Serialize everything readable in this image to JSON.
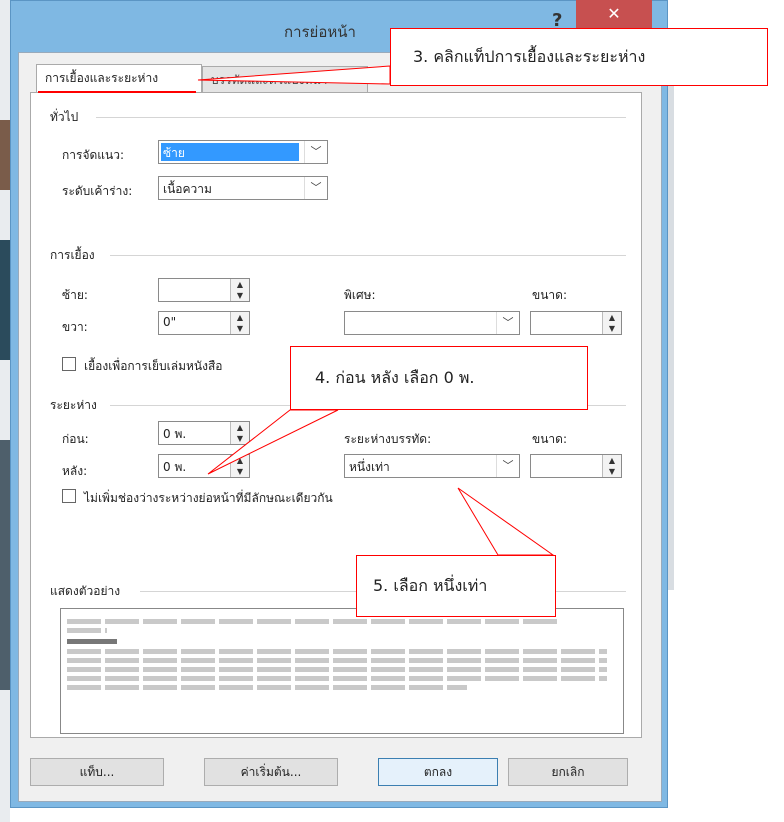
{
  "dialog": {
    "title": "การย่อหน้า",
    "help_label": "?",
    "close_label": "✕"
  },
  "tabs": [
    {
      "label": "การเยื้องและระยะห่าง",
      "active": true
    },
    {
      "label": "บรรทัดและตัวแบ่งหน้า",
      "active": false
    }
  ],
  "general": {
    "heading": "ทั่วไป",
    "alignment_label": "การจัดแนว:",
    "alignment_value": "ซ้าย",
    "outline_label": "ระดับเค้าร่าง:",
    "outline_value": "เนื้อความ"
  },
  "indent": {
    "heading": "การเยื้อง",
    "left_label": "ซ้าย:",
    "left_value": "",
    "right_label": "ขวา:",
    "right_value": "0\"",
    "special_label": "พิเศษ:",
    "special_value": "",
    "by_label": "ขนาด:",
    "by_value": "",
    "mirror_label": "เยื้องเพื่อการเย็บเล่มหนังสือ"
  },
  "spacing": {
    "heading": "ระยะห่าง",
    "before_label": "ก่อน:",
    "before_value": "0 พ.",
    "after_label": "หลัง:",
    "after_value": "0 พ.",
    "line_label": "ระยะห่างบรรทัด:",
    "line_value": "หนึ่งเท่า",
    "at_label": "ขนาด:",
    "at_value": "",
    "no_space_label": "ไม่เพิ่มช่องว่างระหว่างย่อหน้าที่มีลักษณะเดียวกัน"
  },
  "preview": {
    "heading": "แสดงตัวอย่าง"
  },
  "buttons": {
    "tabs": "แท็บ...",
    "default": "ค่าเริ่มต้น...",
    "ok": "ตกลง",
    "cancel": "ยกเลิก"
  },
  "callouts": {
    "step3": "3. คลิกแท็ปการเยื้องและระยะห่าง",
    "step4": "4. ก่อน หลัง  เลือก 0 พ.",
    "step5": "5. เลือก หนึ่งเท่า"
  },
  "colors": {
    "annotation": "#ff0000",
    "selection": "#3399ff",
    "close": "#c75050"
  }
}
